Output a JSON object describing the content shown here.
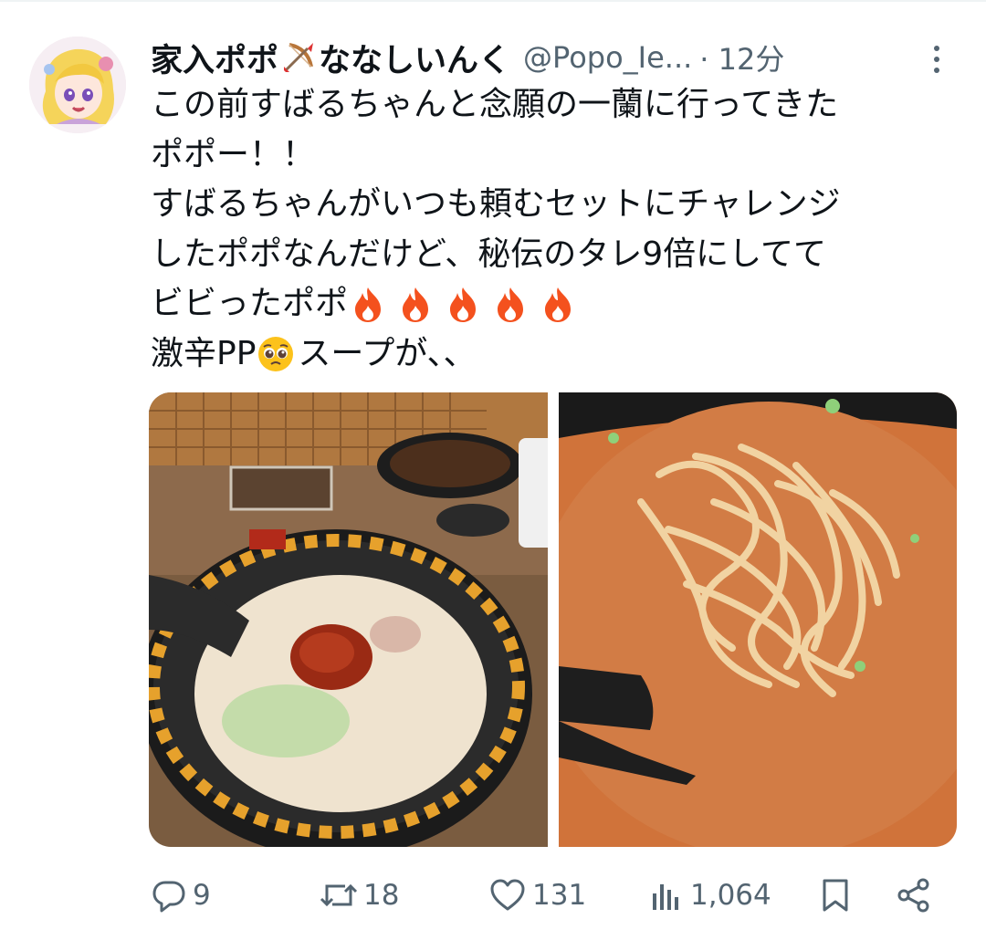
{
  "header": {
    "name_part1": "家入ポポ",
    "name_part2": "ななしいんく",
    "handle": "@Popo_Ie...",
    "time": "· 12分"
  },
  "tweet_lines": [
    "この前すばるちゃんと念願の一蘭に行ってきた",
    "ポポー！！",
    "すばるちゃんがいつも頼むセットにチャレンジ",
    "したポポなんだけど、秘伝のタレ9倍にしてて",
    "ビビったポポ",
    "激辛PP",
    "スープが、、"
  ],
  "icons": {
    "avatar": "avatar-icon",
    "bow": "bow-and-arrow-emoji",
    "fire": "fire-emoji",
    "pleading": "pleading-face-emoji",
    "more": "more-vertical-icon",
    "reply": "reply-icon",
    "retweet": "retweet-icon",
    "like": "like-icon",
    "views": "views-icon",
    "bookmark": "bookmark-icon",
    "share": "share-icon"
  },
  "actions": {
    "replies": "9",
    "retweets": "18",
    "likes": "131",
    "views": "1,064"
  },
  "colors": {
    "text": "#0f1419",
    "secondary": "#536471",
    "fire": "#f4511e"
  }
}
